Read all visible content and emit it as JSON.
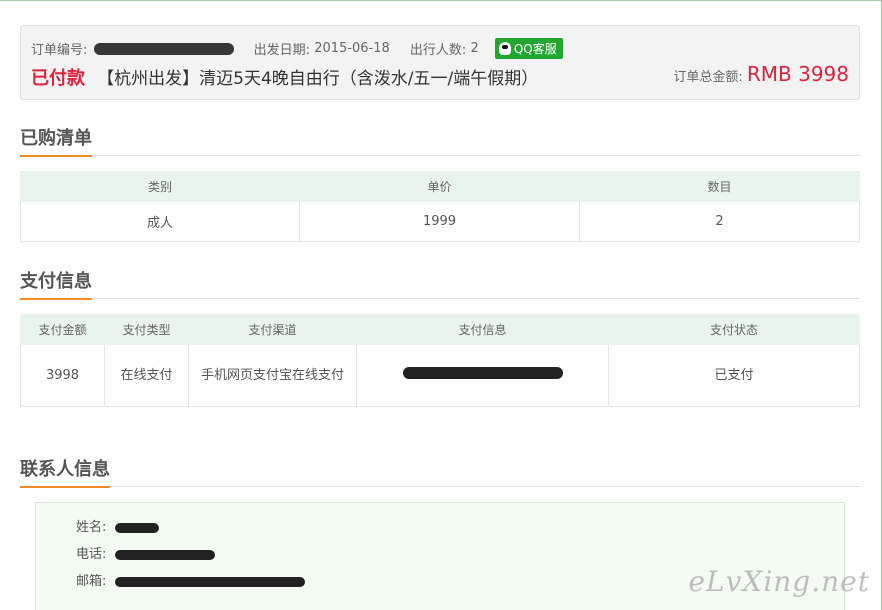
{
  "order": {
    "number_label": "订单编号:",
    "date_label": "出发日期:",
    "date_value": "2015-06-18",
    "people_label": "出行人数:",
    "people_value": "2",
    "qq_label": "QQ客服",
    "status": "已付款",
    "title": "【杭州出发】清迈5天4晚自由行（含泼水/五一/端午假期）",
    "total_label": "订单总金额:",
    "total_value": "RMB 3998"
  },
  "purchased": {
    "heading": "已购清单",
    "columns": [
      "类别",
      "单价",
      "数目"
    ],
    "rows": [
      [
        "成人",
        "1999",
        "2"
      ]
    ]
  },
  "payment": {
    "heading": "支付信息",
    "columns": [
      "支付金额",
      "支付类型",
      "支付渠道",
      "支付信息",
      "支付状态"
    ],
    "row": {
      "amount": "3998",
      "type": "在线支付",
      "channel": "手机网页支付宝在线支付",
      "status": "已支付"
    }
  },
  "contact": {
    "heading": "联系人信息",
    "name_label": "姓名:",
    "phone_label": "电话:",
    "email_label": "邮箱:"
  },
  "watermark": "eLvXing.net"
}
